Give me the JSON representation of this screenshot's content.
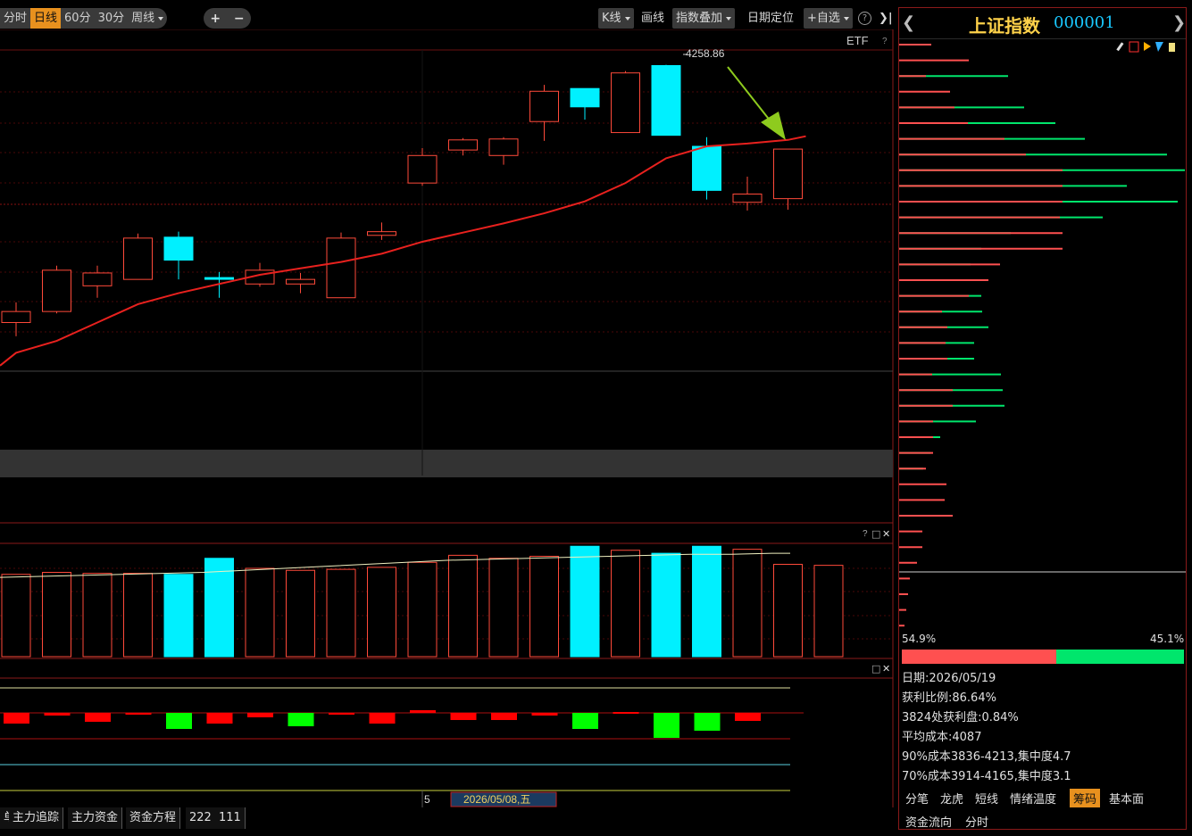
{
  "toolbar": {
    "periods": [
      "分时",
      "日线",
      "60分",
      "30分",
      "周线"
    ],
    "active_period": "日线",
    "zoom_in": "+",
    "zoom_out": "−",
    "kline_label": "K线",
    "draw_label": "画线",
    "overlay_label": "指数叠加",
    "date_locate_label": "日期定位",
    "watchlist_label": "+自选",
    "help": "?",
    "collapse": "❯|"
  },
  "main_chart": {
    "etf_label": "ETF",
    "help": "?",
    "high_label": "4258.86"
  },
  "chart_data": {
    "type": "candlestick",
    "candles": [
      {
        "open": 3978,
        "close": 3990,
        "high": 4000,
        "low": 3963
      },
      {
        "open": 3990,
        "close": 4035,
        "high": 4040,
        "low": 3988
      },
      {
        "open": 4018,
        "close": 4032,
        "high": 4040,
        "low": 4005
      },
      {
        "open": 4025,
        "close": 4070,
        "high": 4075,
        "low": 4025
      },
      {
        "open": 4071,
        "close": 4046,
        "high": 4077,
        "low": 4025
      },
      {
        "open": 4027,
        "close": 4026,
        "high": 4033,
        "low": 4005
      },
      {
        "open": 4020,
        "close": 4035,
        "high": 4043,
        "low": 4017
      },
      {
        "open": 4020,
        "close": 4025,
        "high": 4032,
        "low": 4010
      },
      {
        "open": 4005,
        "close": 4070,
        "high": 4076,
        "low": 4005
      },
      {
        "open": 4073,
        "close": 4077,
        "high": 4087,
        "low": 4068
      },
      {
        "open": 4130,
        "close": 4160,
        "high": 4168,
        "low": 4127
      },
      {
        "open": 4166,
        "close": 4177,
        "high": 4179,
        "low": 4160
      },
      {
        "open": 4160,
        "close": 4178,
        "high": 4180,
        "low": 4150
      },
      {
        "open": 4197,
        "close": 4230,
        "high": 4237,
        "low": 4176
      },
      {
        "open": 4233,
        "close": 4213,
        "high": 4233,
        "low": 4199
      },
      {
        "open": 4185,
        "close": 4250,
        "high": 4252,
        "low": 4185
      },
      {
        "open": 4258,
        "close": 4182,
        "high": 4258.86,
        "low": 4182
      },
      {
        "open": 4170,
        "close": 4122,
        "high": 4180,
        "low": 4112
      },
      {
        "open": 4109,
        "close": 4118,
        "high": 4137,
        "low": 4100
      },
      {
        "open": 4113,
        "close": 4167,
        "high": 4167,
        "low": 4101
      }
    ],
    "ma": [
      3945,
      3958,
      3978,
      3998,
      4010,
      4020,
      4030,
      4037,
      4044,
      4053,
      4066,
      4076,
      4086,
      4097,
      4110,
      4130,
      4157,
      4170,
      4173,
      4177
    ],
    "volume": [
      82,
      84,
      83,
      83,
      82,
      98,
      88,
      86,
      87,
      89,
      94,
      101,
      98,
      100,
      110,
      106,
      103,
      110,
      107,
      92,
      91
    ],
    "volume_ma": [
      79,
      80,
      81,
      82,
      83,
      84,
      86,
      88,
      90,
      92,
      94,
      96,
      97,
      98,
      99,
      100,
      101,
      102,
      102,
      103
    ],
    "flow": [
      -12,
      -3,
      -10,
      -1,
      -18,
      -12,
      -5,
      -15,
      -2,
      -12,
      3,
      -8,
      -8,
      -3,
      -18,
      1,
      -28,
      -20,
      -9
    ],
    "chip_profile_up": [
      36,
      78,
      30,
      57,
      62,
      77,
      118,
      142,
      183,
      183,
      183,
      180,
      183,
      183,
      113,
      100,
      78,
      48,
      54,
      52,
      54,
      37,
      60,
      60,
      38,
      38,
      38,
      30,
      53,
      51,
      60,
      26,
      26,
      20,
      12,
      10,
      8,
      6,
      5,
      4,
      3
    ],
    "chip_profile_down": [
      0,
      0,
      0,
      0,
      0,
      0,
      0,
      0,
      0,
      0,
      0,
      0,
      0,
      0,
      0,
      0,
      0,
      0,
      0,
      0,
      0,
      0,
      0,
      0,
      0,
      0,
      0,
      0,
      0,
      0,
      0,
      0,
      0,
      0,
      0,
      0,
      0,
      0,
      0,
      0,
      0
    ],
    "chip_profile_green": [
      0,
      0,
      122,
      0,
      140,
      175,
      208,
      300,
      320,
      255,
      312,
      228,
      125,
      92,
      80,
      78,
      92,
      93,
      100,
      84,
      84,
      114,
      116,
      118,
      86,
      46,
      35,
      27,
      0,
      0,
      0,
      0,
      0,
      0,
      0,
      0,
      0,
      0,
      0,
      0,
      0
    ],
    "ylim": [
      3925,
      4275
    ]
  },
  "date_bar": {
    "marker": "5",
    "cursor_date": "2026/05/08,五"
  },
  "panels": {
    "volume_help": "?",
    "volume_max": "□",
    "volume_close": "✕",
    "flow_max": "□",
    "flow_close": "✕"
  },
  "right_panel": {
    "name": "上证指数",
    "code": "000001",
    "prev": "❮",
    "next": "❯",
    "profit_pct": "54.9%",
    "loss_pct": "45.1%",
    "profit_ratio": 0.549,
    "info": [
      "日期:2026/05/19",
      "获利比例:86.64%",
      "3824处获利盘:0.84%",
      "平均成本:4087",
      "90%成本3836-4213,集中度4.7",
      "70%成本3914-4165,集中度3.1"
    ],
    "tabs_row1": [
      "分笔",
      "龙虎",
      "短线",
      "情绪温度",
      "筹码",
      "基本面"
    ],
    "active_tab": "筹码",
    "tabs_row2": [
      "资金流向",
      "分时"
    ],
    "colors": {
      "profit": "#ff5050",
      "loss": "#00e66c"
    }
  },
  "bottom_tabs": [
    "单",
    "主力追踪",
    "主力资金",
    "资金方程",
    "222",
    "111"
  ],
  "colors": {
    "up": "#ff4a3a",
    "down": "#00f0ff",
    "ma": "#e8211e",
    "grid": "#5a0a0a",
    "flow_up": "#ff0000",
    "flow_down": "#00ff00",
    "accent": "#e8911e"
  }
}
